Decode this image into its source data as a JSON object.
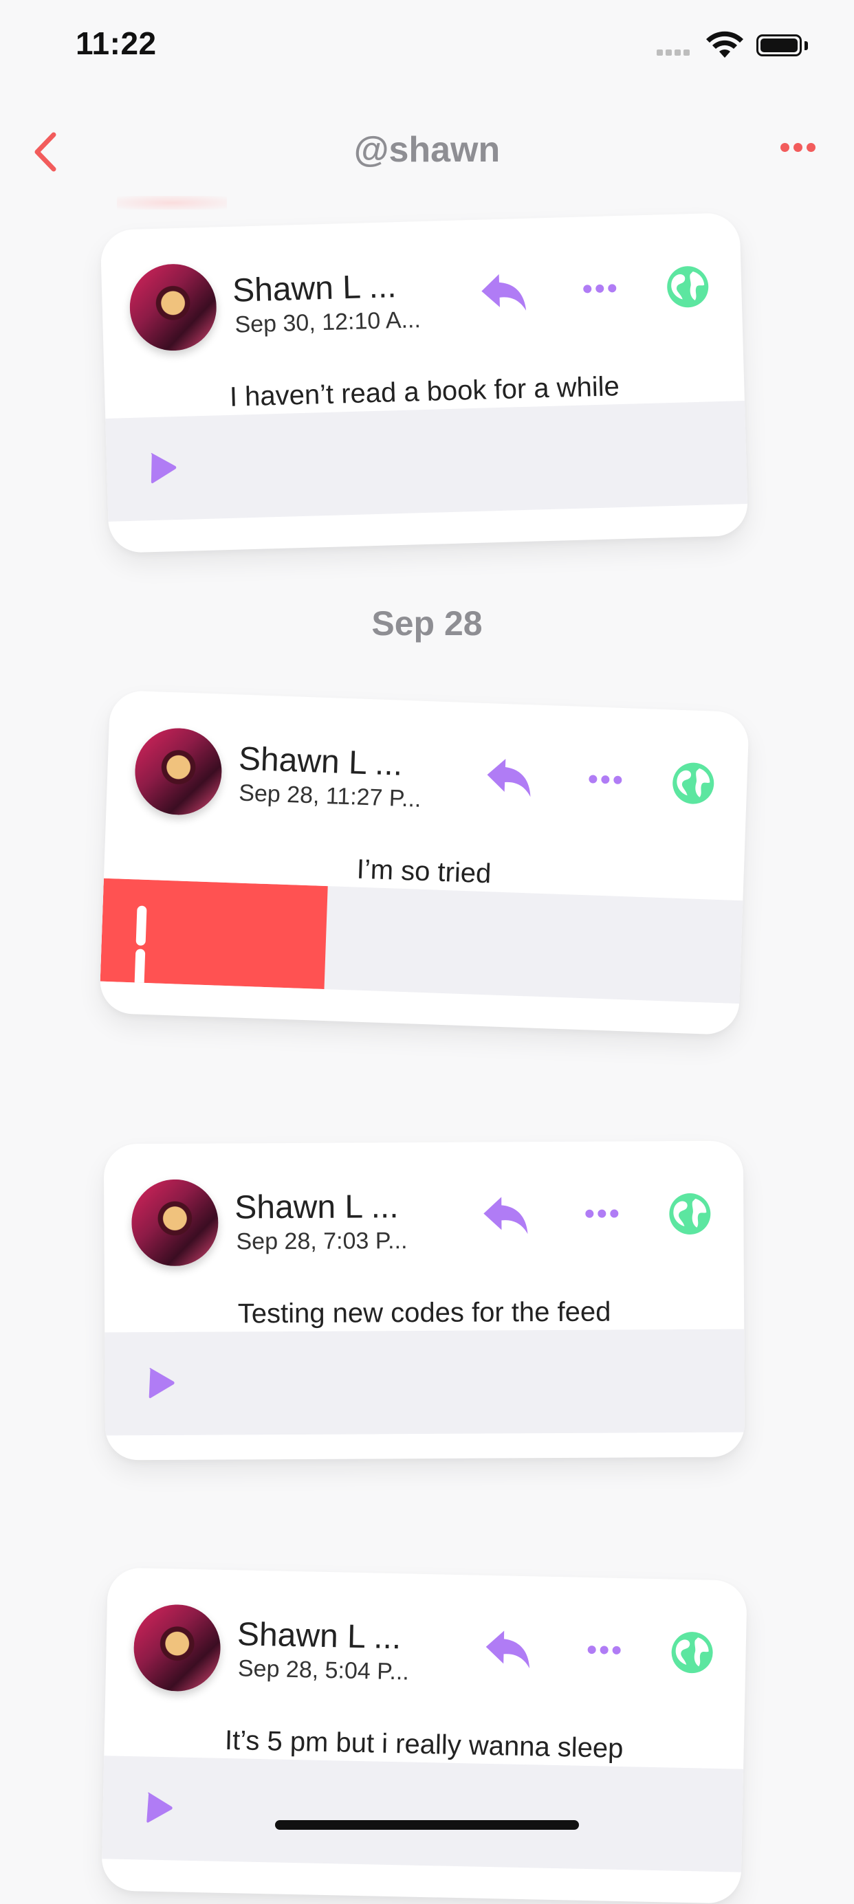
{
  "status_bar": {
    "time": "11:22"
  },
  "nav": {
    "title": "@shawn",
    "back_icon": "chevron-left-icon",
    "more_icon": "ellipsis-icon"
  },
  "colors": {
    "accent": "#f25c5c",
    "reply": "#b07cf5",
    "globe": "#5ce6a0",
    "player_bg": "#f0f0f4",
    "progress": "#ff5252"
  },
  "date_header": "Sep 28",
  "posts": [
    {
      "author": "Shawn L ...",
      "time": "Sep 30, 12:10 A...",
      "text": "I haven’t read a book for a while",
      "state": "paused"
    },
    {
      "author": "Shawn L ...",
      "time": "Sep 28, 11:27 P...",
      "text": "I’m so tried",
      "state": "playing",
      "progress": 0.35
    },
    {
      "author": "Shawn L ...",
      "time": "Sep 28, 7:03 P...",
      "text": "Testing new codes for the feed",
      "state": "paused"
    },
    {
      "author": "Shawn L ...",
      "time": "Sep 28, 5:04 P...",
      "text": "It’s 5 pm but i really wanna sleep",
      "state": "paused"
    }
  ]
}
